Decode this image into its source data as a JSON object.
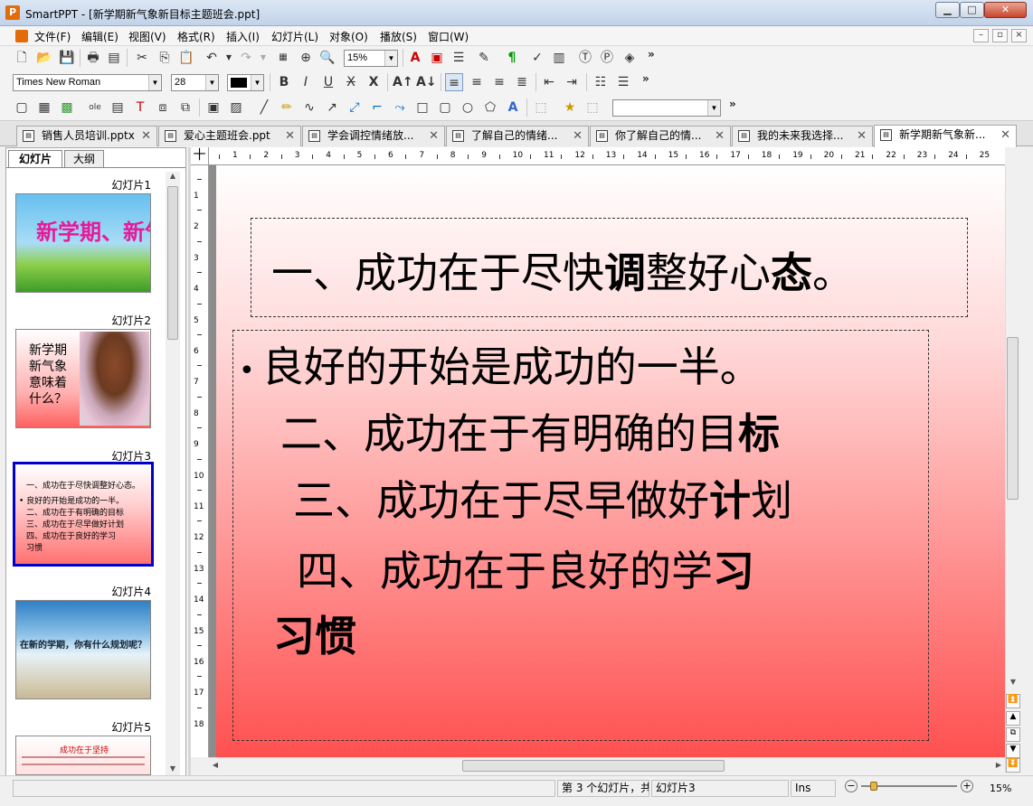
{
  "app": {
    "name": "SmartPPT",
    "title": "SmartPPT - [新学期新气象新目标主题班会.ppt]",
    "min_glyph": "▁",
    "max_glyph": "□",
    "close_glyph": "✕"
  },
  "menu": [
    "文件(F)",
    "编辑(E)",
    "视图(V)",
    "格式(R)",
    "插入(I)",
    "幻灯片(L)",
    "对象(O)",
    "播放(S)",
    "窗口(W)"
  ],
  "mdi_buttons": [
    "–",
    "▫",
    "×"
  ],
  "toolbar": {
    "zoom_value": "15%",
    "font_name": "Times New Roman",
    "font_size": "28",
    "more": "»"
  },
  "tabs": [
    {
      "label": "销售人员培训.pptx"
    },
    {
      "label": "爱心主题班会.ppt"
    },
    {
      "label": "学会调控情绪放..."
    },
    {
      "label": "了解自己的情绪..."
    },
    {
      "label": "你了解自己的情..."
    },
    {
      "label": "我的未来我选择..."
    },
    {
      "label": "新学期新气象新..."
    }
  ],
  "tab_close": "✕",
  "left_panel": {
    "tabs": [
      "幻灯片",
      "大纲"
    ],
    "slides": [
      {
        "label": "幻灯片1",
        "thumb_text": "新学期、新气象"
      },
      {
        "label": "幻灯片2",
        "thumb_text": [
          "新学期",
          "新气象",
          "意味着",
          "什么？"
        ]
      },
      {
        "label": "幻灯片3",
        "thumb_text": [
          "一、成功在于尽快调整好心态。",
          "• 良好的开始是成功的一半。",
          "二、成功在于有明确的目标",
          "三、成功在于尽早做好计划",
          "四、成功在于良好的学习",
          "习惯"
        ]
      },
      {
        "label": "幻灯片4",
        "thumb_text": "在新的学期，你有什么规划呢？"
      },
      {
        "label": "幻灯片5",
        "thumb_text": "成功在于坚持"
      }
    ]
  },
  "ruler": {
    "h_ticks": [
      "1",
      "2",
      "3",
      "4",
      "5",
      "6",
      "7",
      "8",
      "9",
      "10",
      "11",
      "12",
      "13",
      "14",
      "15",
      "16",
      "17",
      "18",
      "19",
      "20",
      "21",
      "22",
      "23",
      "24",
      "25"
    ],
    "v_ticks": [
      "1",
      "2",
      "3",
      "4",
      "5",
      "6",
      "7",
      "8",
      "9",
      "10",
      "11",
      "12",
      "13",
      "14",
      "15",
      "16",
      "17",
      "18"
    ],
    "corner_glyph": "十"
  },
  "slide": {
    "title": {
      "t1": "一、成功在于尽快",
      "b1": "调",
      "t2": "整好心",
      "b2": "态",
      "t3": "。"
    },
    "bullet": "•",
    "lines": [
      {
        "plain": "良好的开始是成功的一半。"
      },
      {
        "plain": "二、成功在于有明确的目",
        "bold": "标"
      },
      {
        "plain": "三、成功在于尽早做好",
        "bold": "计",
        "tail": "划"
      },
      {
        "plain": "四、成功在于良好的学",
        "bold": "习"
      },
      {
        "plain": "",
        "bold": "习惯"
      }
    ]
  },
  "status": {
    "slide_of": "第 3 个幻灯片，共",
    "slide_name": "幻灯片3",
    "mode": "Ins",
    "zoom": "15%"
  },
  "colors": {
    "selection": "#0000cc",
    "slide_gradient_bottom": "#ff5050"
  }
}
